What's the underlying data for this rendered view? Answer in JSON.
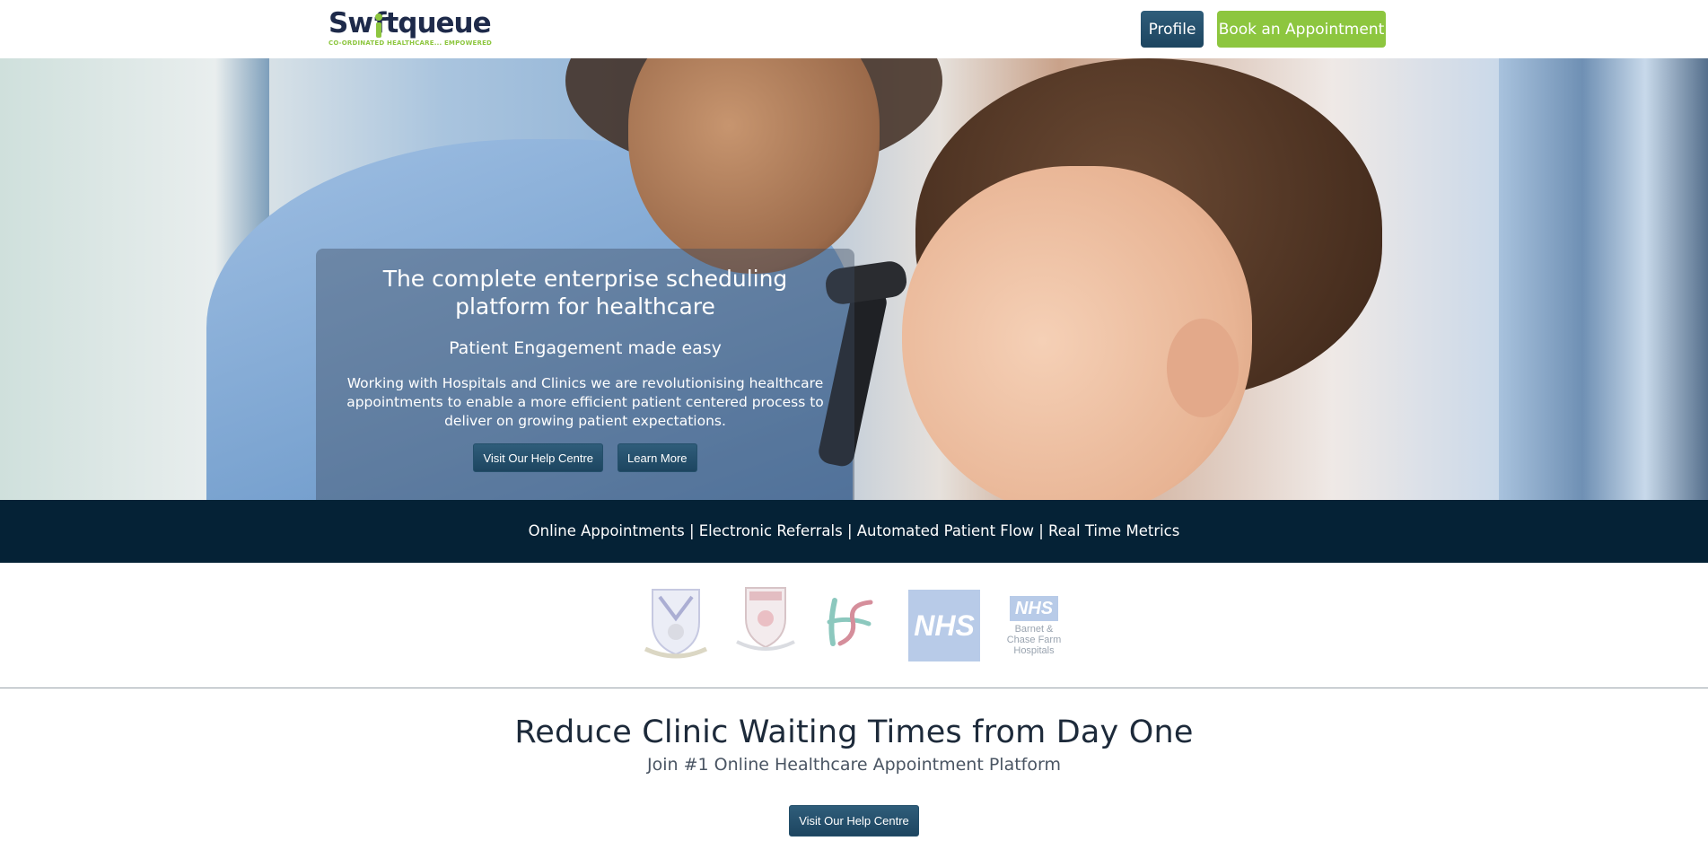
{
  "header": {
    "logo_text": "Swiftqueue",
    "logo_prefix": "Sw",
    "logo_suffix": "ftqueue",
    "logo_tagline": "CO-ORDINATED HEALTHCARE... EMPOWERED",
    "profile_label": "Profile",
    "book_label": "Book an Appointment"
  },
  "hero": {
    "title": "The complete enterprise scheduling platform for healthcare",
    "subtitle": "Patient Engagement made easy",
    "description": "Working with Hospitals and Clinics we are revolutionising healthcare appointments to enable a more efficient patient centered process to deliver on growing patient expectations.",
    "help_button": "Visit Our Help Centre",
    "learn_button": "Learn More"
  },
  "features": {
    "text": "Online Appointments | Electronic Referrals | Automated Patient Flow | Real Time Metrics"
  },
  "partners": {
    "nhs_label": "NHS",
    "nhs_small_label": "NHS",
    "nhs_small_text": "Barnet & Chase Farm Hospitals"
  },
  "cta": {
    "title": "Reduce Clinic Waiting Times from Day One",
    "subtitle": "Join #1 Online Healthcare Appointment Platform",
    "button": "Visit Our Help Centre"
  },
  "colors": {
    "brand_green": "#8dc63f",
    "brand_navy": "#052236",
    "button_blue": "#1d4560"
  }
}
